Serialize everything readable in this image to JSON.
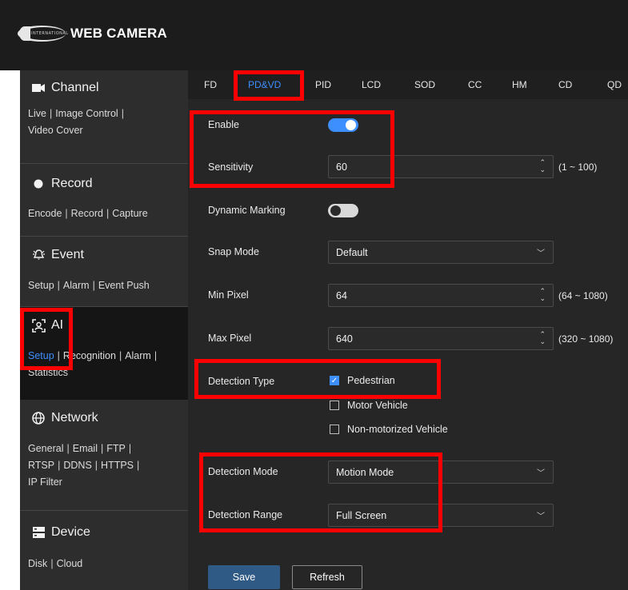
{
  "header": {
    "logo_text": "WEB CAMERA",
    "logo_mark_text": "INTERNATIONAL"
  },
  "sidebar": {
    "sections": [
      {
        "title": "Channel",
        "icon": "camera-icon",
        "links": [
          "Live",
          "Image Control",
          "Video Cover"
        ]
      },
      {
        "title": "Record",
        "icon": "record-icon",
        "links": [
          "Encode",
          "Record",
          "Capture"
        ]
      },
      {
        "title": "Event",
        "icon": "alarm-bell-icon",
        "links": [
          "Setup",
          "Alarm",
          "Event Push"
        ]
      },
      {
        "title": "AI",
        "icon": "ai-face-icon",
        "links": [
          "Setup",
          "Recognition",
          "Alarm",
          "Statistics"
        ]
      },
      {
        "title": "Network",
        "icon": "globe-icon",
        "links": [
          "General",
          "Email",
          "FTP",
          "RTSP",
          "DDNS",
          "HTTPS",
          "IP Filter"
        ]
      },
      {
        "title": "Device",
        "icon": "storage-icon",
        "links": [
          "Disk",
          "Cloud"
        ]
      }
    ]
  },
  "tabs": [
    "FD",
    "PD&VD",
    "PID",
    "LCD",
    "SOD",
    "CC",
    "HM",
    "CD",
    "QD"
  ],
  "active_tab": "PD&VD",
  "form": {
    "enable": {
      "label": "Enable",
      "on": true
    },
    "sensitivity": {
      "label": "Sensitivity",
      "value": "60",
      "range": "(1 ~ 100)"
    },
    "dynamic_marking": {
      "label": "Dynamic Marking",
      "on": false
    },
    "snap_mode": {
      "label": "Snap Mode",
      "value": "Default"
    },
    "min_pixel": {
      "label": "Min Pixel",
      "value": "64",
      "range": "(64 ~ 1080)"
    },
    "max_pixel": {
      "label": "Max Pixel",
      "value": "640",
      "range": "(320 ~ 1080)"
    },
    "detection_type": {
      "label": "Detection Type",
      "options": [
        {
          "label": "Pedestrian",
          "checked": true
        },
        {
          "label": "Motor Vehicle",
          "checked": false
        },
        {
          "label": "Non-motorized Vehicle",
          "checked": false
        }
      ]
    },
    "detection_mode": {
      "label": "Detection Mode",
      "value": "Motion Mode"
    },
    "detection_range": {
      "label": "Detection Range",
      "value": "Full Screen"
    }
  },
  "buttons": {
    "save": "Save",
    "refresh": "Refresh"
  },
  "colors": {
    "accent": "#3d8fff",
    "highlight": "#ff0000",
    "header_bg": "#1c1c1c",
    "panel_bg": "#262626"
  }
}
